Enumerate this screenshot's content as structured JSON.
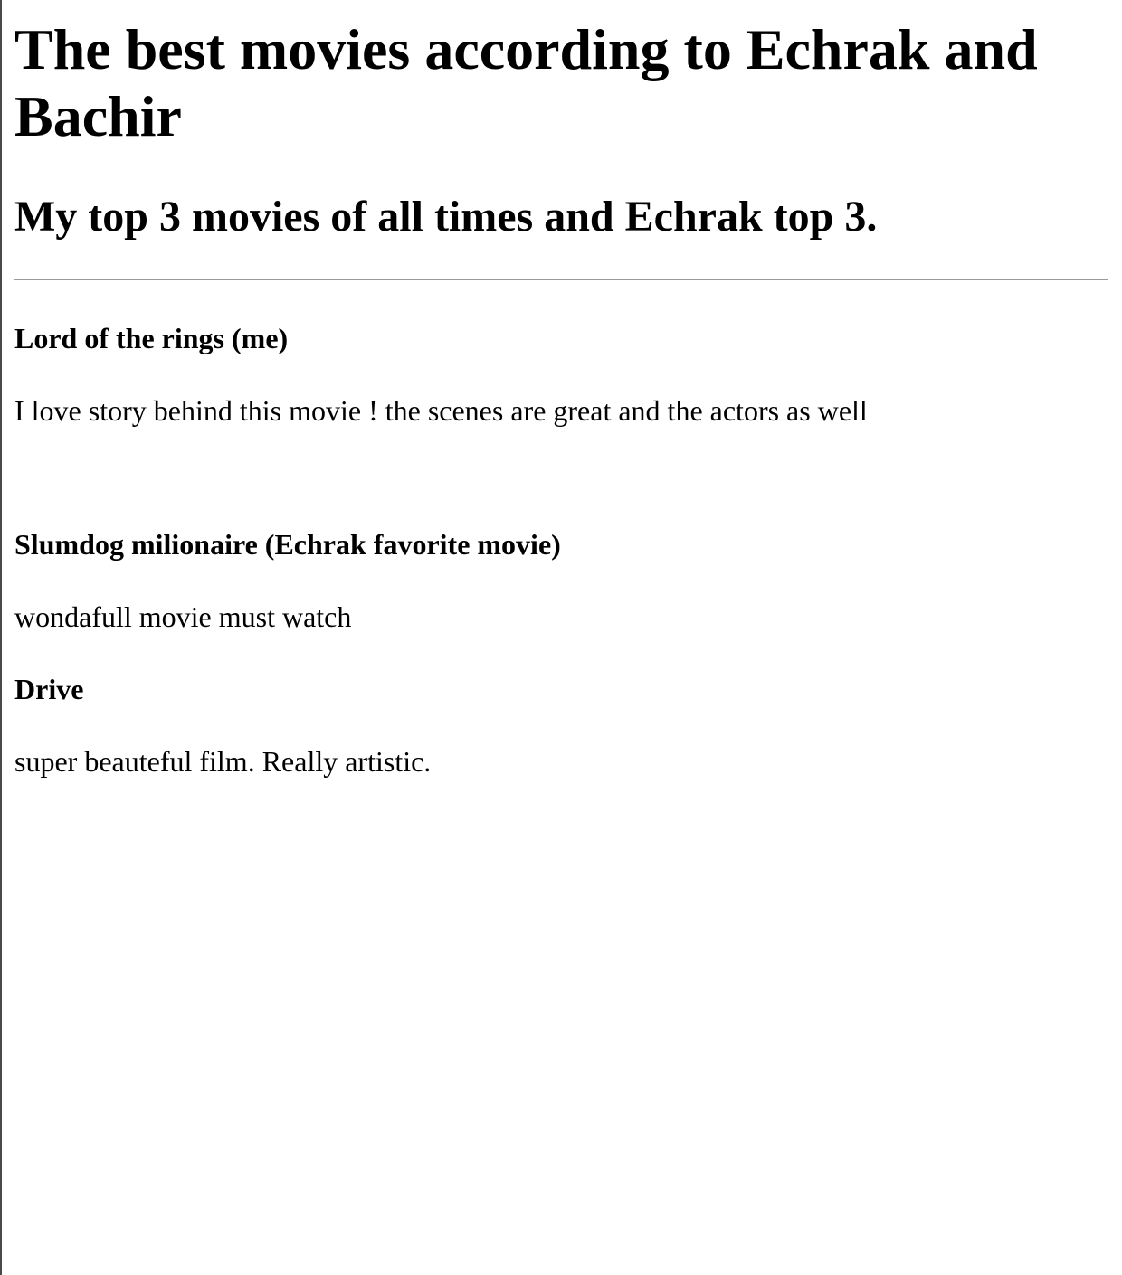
{
  "page": {
    "title": "The best movies according to Echrak and Bachir",
    "subtitle": "My top 3 movies of all times and Echrak top 3."
  },
  "movies": [
    {
      "title": "Lord of the rings (me)",
      "review": "I love story behind this movie ! the scenes are great and the actors as well"
    },
    {
      "title": "Slumdog milionaire (Echrak favorite movie)",
      "review": "wondafull movie must watch"
    },
    {
      "title": "Drive",
      "review": "super beauteful film. Really artistic."
    }
  ]
}
